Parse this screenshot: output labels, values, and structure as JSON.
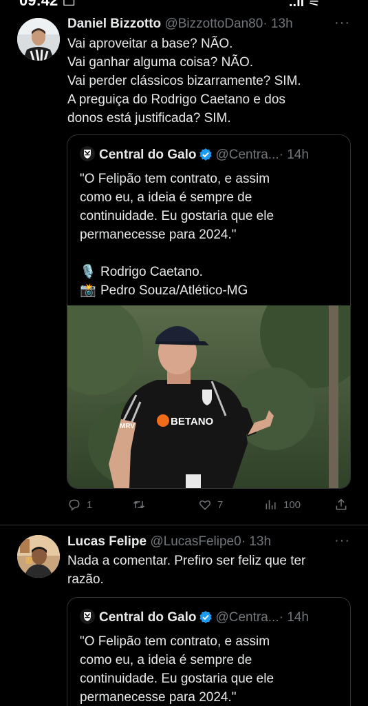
{
  "status": {
    "time": "09:42 ☐",
    "signal": "..ıl ⚟"
  },
  "tweets": [
    {
      "name": "Daniel Bizzotto",
      "handle": "@BizzottoDan80",
      "time": "· 13h",
      "more": "···",
      "lines": [
        "Vai aproveitar a base? NÃO.",
        "Vai ganhar alguma coisa? NÃO.",
        "Vai perder clássicos bizarramente? SIM.",
        "A preguiça do Rodrigo Caetano e dos",
        "donos está justificada? SIM."
      ],
      "quote": {
        "name": "Central do Galo",
        "handle": "@Centra...",
        "time": "· 14h",
        "lines": [
          "\"O Felipão tem contrato, e assim",
          "como eu, a ideia é sempre de",
          "continuidade. Eu gostaria que ele",
          "permanecesse para 2024.\""
        ],
        "credits": [
          {
            "emoji": "🎙️",
            "text": "Rodrigo Caetano."
          },
          {
            "emoji": "📸",
            "text": "Pedro Souza/Atlético-MG"
          }
        ],
        "photo": {
          "sponsor": "BETANO",
          "brand": "MRV"
        }
      },
      "actions": {
        "replies": "1",
        "retweets": "",
        "likes": "7",
        "views": "100"
      }
    },
    {
      "name": "Lucas Felipe",
      "handle": "@LucasFelipe0",
      "time": "· 13h",
      "more": "···",
      "lines": [
        "Nada a comentar. Prefiro ser feliz que ter",
        "razão."
      ],
      "quote": {
        "name": "Central do Galo",
        "handle": "@Centra...",
        "time": "· 14h",
        "lines": [
          "\"O Felipão tem contrato, e assim",
          "como eu, a ideia é sempre de",
          "continuidade. Eu gostaria que ele",
          "permanecesse para 2024.\""
        ]
      }
    }
  ],
  "colors": {
    "background": "#000000",
    "text": "#e7e9ea",
    "muted": "#71767b",
    "border": "#2f3336",
    "verified": "#1d9bf0"
  }
}
